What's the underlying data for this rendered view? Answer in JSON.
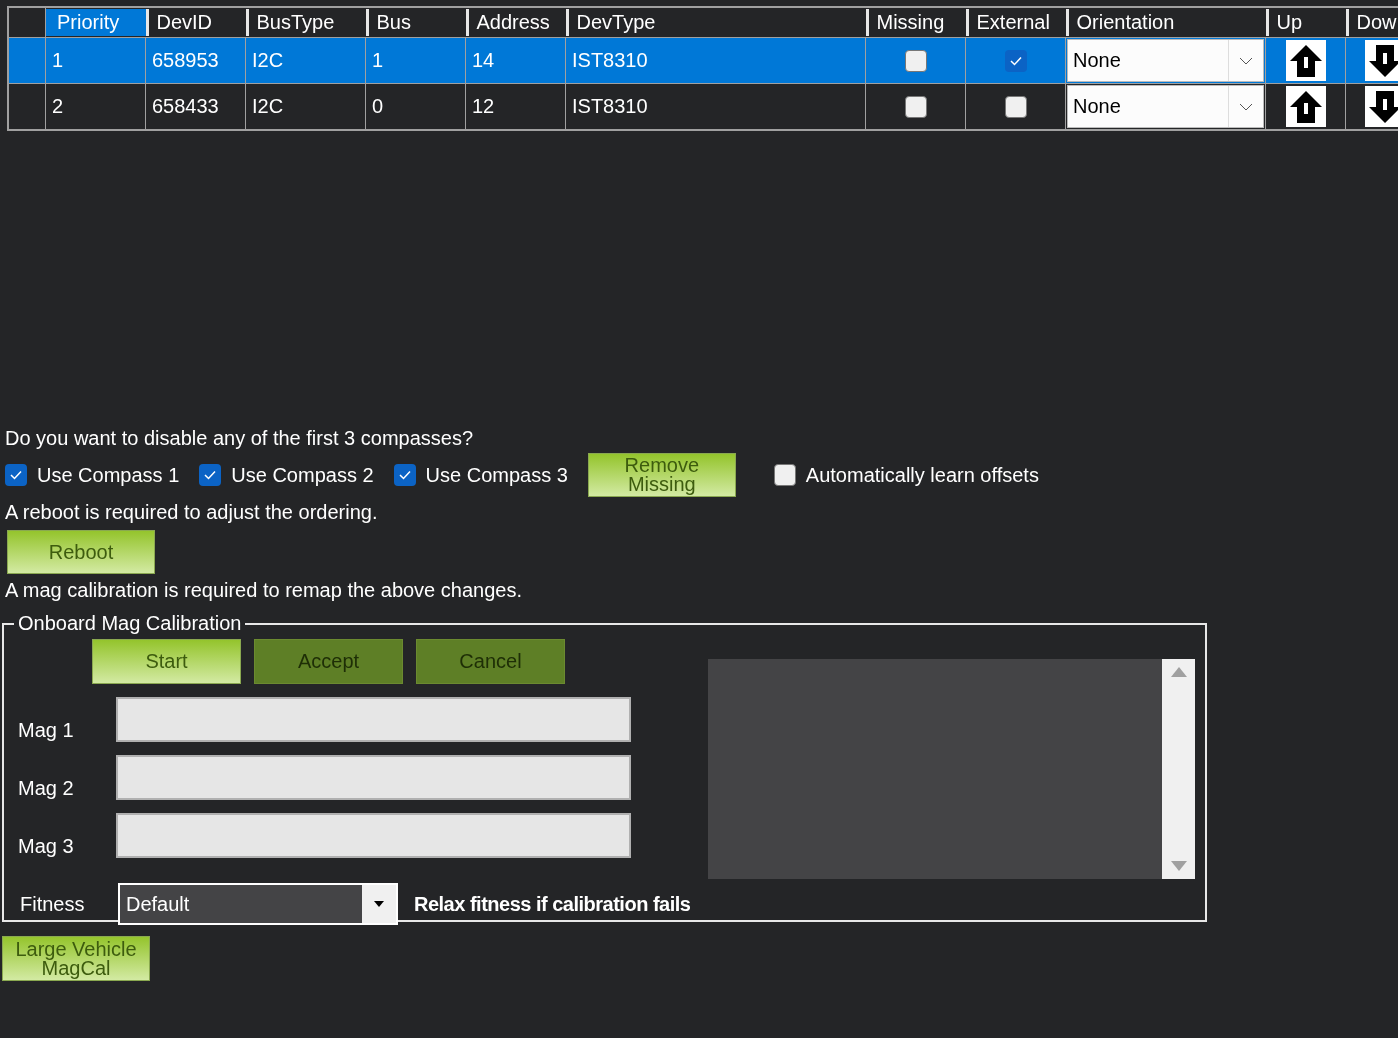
{
  "table": {
    "columns": [
      {
        "label": "Priority",
        "selected": true
      },
      {
        "label": "DevID",
        "selected": false
      },
      {
        "label": "BusType",
        "selected": false
      },
      {
        "label": "Bus",
        "selected": false
      },
      {
        "label": "Address",
        "selected": false
      },
      {
        "label": "DevType",
        "selected": false
      },
      {
        "label": "Missing",
        "selected": false
      },
      {
        "label": "External",
        "selected": false
      },
      {
        "label": "Orientation",
        "selected": false
      },
      {
        "label": "Up",
        "selected": false
      },
      {
        "label": "Dow",
        "selected": false
      }
    ],
    "rows": [
      {
        "selected": true,
        "priority": "1",
        "devid": "658953",
        "bustype": "I2C",
        "bus": "1",
        "address": "14",
        "devtype": "IST8310",
        "missing": false,
        "external": true,
        "orientation": "None"
      },
      {
        "selected": false,
        "priority": "2",
        "devid": "658433",
        "bustype": "I2C",
        "bus": "0",
        "address": "12",
        "devtype": "IST8310",
        "missing": false,
        "external": false,
        "orientation": "None"
      }
    ]
  },
  "disable_prompt": "Do you want to disable any of the first 3 compasses?",
  "compass_checks": [
    {
      "label": "Use Compass 1",
      "checked": true
    },
    {
      "label": "Use Compass 2",
      "checked": true
    },
    {
      "label": "Use Compass 3",
      "checked": true
    }
  ],
  "remove_missing_button": "Remove Missing",
  "auto_learn": {
    "label": "Automatically learn offsets",
    "checked": false
  },
  "reboot_note": "A reboot is required to adjust the ordering.",
  "reboot_button": "Reboot",
  "mag_note": "A mag calibration is required to remap the above changes.",
  "onboard": {
    "title": "Onboard Mag Calibration",
    "buttons": [
      {
        "label": "Start",
        "disabled": false
      },
      {
        "label": "Accept",
        "disabled": true
      },
      {
        "label": "Cancel",
        "disabled": true
      }
    ],
    "mags": [
      {
        "label": "Mag 1"
      },
      {
        "label": "Mag 2"
      },
      {
        "label": "Mag 3"
      }
    ],
    "fitness": {
      "label": "Fitness",
      "value": "Default"
    },
    "relax_label": "Relax fitness if calibration fails"
  },
  "large_vehicle_button": "Large Vehicle MagCal"
}
